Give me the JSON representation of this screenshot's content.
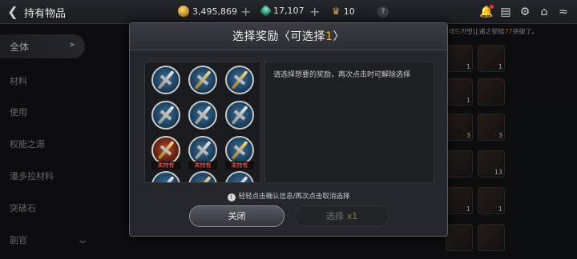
{
  "header": {
    "title": "持有物品",
    "gold": "3,495,869",
    "gems": "17,107",
    "crowns": "10",
    "help_label": "?"
  },
  "sidebar": {
    "items": [
      "全体",
      "材料",
      "使用",
      "权能之源",
      "潘多拉材料",
      "突破石",
      "副官"
    ]
  },
  "inventory": {
    "promo_prefix": "레드카펫",
    "promo_mid": "让诸之锁链",
    "promo_highlight": "77",
    "promo_suffix": "突破了。",
    "counts": [
      "1",
      "1",
      "1",
      "1",
      "3",
      "3",
      "13",
      "1",
      "1"
    ]
  },
  "modal": {
    "title_prefix": "选择奖励〈可选择",
    "title_count": "1",
    "title_suffix": "〉",
    "description": "请选择想要的奖励，再次点击时可解除选择",
    "not_owned": "未持有",
    "hint": "轻轻点击确认信息/再次点击取消选择",
    "close_label": "关闭",
    "select_label": "选择",
    "select_qty": "x1"
  },
  "colors": {
    "accent_gold": "#f3b43a",
    "not_owned_red": "#ff6a5a",
    "panel_bg": "#25272c"
  }
}
